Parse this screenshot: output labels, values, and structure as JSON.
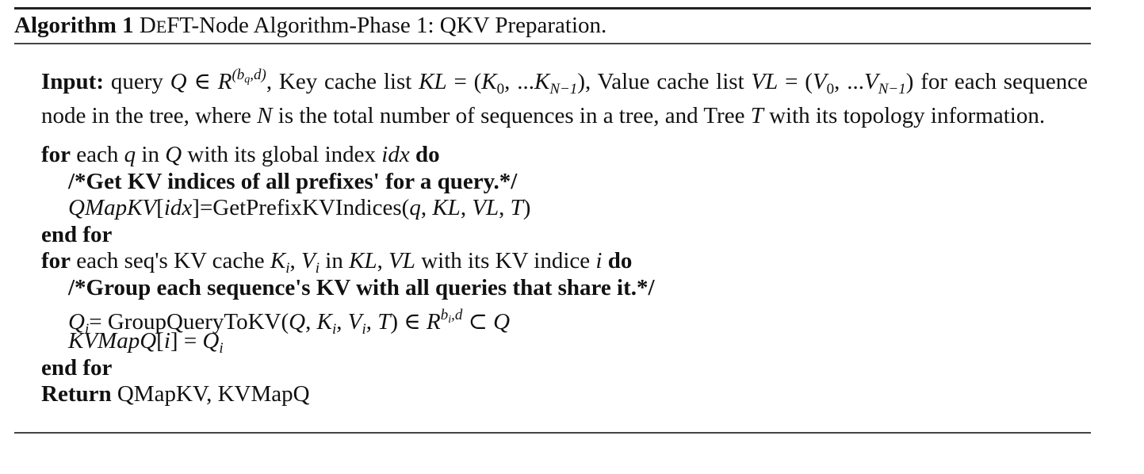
{
  "caption": [
    {
      "t": "Algorithm 1",
      "s": "b"
    },
    {
      "t": " D",
      "s": "n"
    },
    {
      "t": "E",
      "s": "sc"
    },
    {
      "t": "FT-Node Algorithm-Phase 1: QKV Preparation.",
      "s": "n"
    }
  ],
  "input": [
    {
      "t": "Input:",
      "s": "b"
    },
    {
      "t": "  query ",
      "s": "n"
    },
    {
      "t": "Q",
      "s": "i"
    },
    {
      "t": " ∈ ",
      "s": "n"
    },
    {
      "t": "R",
      "s": "i"
    },
    {
      "t": "(b",
      "s": "sup"
    },
    {
      "t": "q",
      "s": "supsub"
    },
    {
      "t": ",d)",
      "s": "sup"
    },
    {
      "t": ", Key cache list ",
      "s": "n"
    },
    {
      "t": "KL",
      "s": "i"
    },
    {
      "t": " = (",
      "s": "n"
    },
    {
      "t": "K",
      "s": "i"
    },
    {
      "t": "0",
      "s": "subn"
    },
    {
      "t": ", ...",
      "s": "n"
    },
    {
      "t": "K",
      "s": "i"
    },
    {
      "t": "N−1",
      "s": "sub"
    },
    {
      "t": "), Value cache list ",
      "s": "n"
    },
    {
      "t": "VL",
      "s": "i"
    },
    {
      "t": " = (",
      "s": "n"
    },
    {
      "t": "V",
      "s": "i"
    },
    {
      "t": "0",
      "s": "subn"
    },
    {
      "t": ", ...",
      "s": "n"
    },
    {
      "t": "V",
      "s": "i"
    },
    {
      "t": "N−1",
      "s": "sub"
    },
    {
      "t": ") for each sequence node in the tree, where ",
      "s": "n"
    },
    {
      "t": "N",
      "s": "i"
    },
    {
      "t": " is the total number of sequences in a tree, and Tree ",
      "s": "n"
    },
    {
      "t": "T",
      "s": "i"
    },
    {
      "t": " with its topology information.",
      "s": "n"
    }
  ],
  "lines": [
    {
      "indent": 0,
      "segs": [
        {
          "t": "for",
          "s": "b"
        },
        {
          "t": " each ",
          "s": "n"
        },
        {
          "t": "q",
          "s": "i"
        },
        {
          "t": " in ",
          "s": "n"
        },
        {
          "t": "Q",
          "s": "i"
        },
        {
          "t": " with its global index ",
          "s": "n"
        },
        {
          "t": "idx",
          "s": "i"
        },
        {
          "t": " do",
          "s": "b"
        }
      ]
    },
    {
      "indent": 1,
      "segs": [
        {
          "t": "/*Get KV indices of all prefixes' for a query.*/",
          "s": "b"
        }
      ]
    },
    {
      "indent": 1,
      "segs": [
        {
          "t": "QMapKV",
          "s": "i"
        },
        {
          "t": "[",
          "s": "n"
        },
        {
          "t": "idx",
          "s": "i"
        },
        {
          "t": "]=GetPrefixKVIndices(",
          "s": "n"
        },
        {
          "t": "q",
          "s": "i"
        },
        {
          "t": ", ",
          "s": "n"
        },
        {
          "t": "KL",
          "s": "i"
        },
        {
          "t": ", ",
          "s": "n"
        },
        {
          "t": "VL",
          "s": "i"
        },
        {
          "t": ", ",
          "s": "n"
        },
        {
          "t": "T",
          "s": "i"
        },
        {
          "t": ")",
          "s": "n"
        }
      ]
    },
    {
      "indent": 0,
      "segs": [
        {
          "t": "end for",
          "s": "b"
        }
      ]
    },
    {
      "indent": 0,
      "segs": [
        {
          "t": "for",
          "s": "b"
        },
        {
          "t": " each seq's KV cache ",
          "s": "n"
        },
        {
          "t": "K",
          "s": "i"
        },
        {
          "t": "i",
          "s": "sub"
        },
        {
          "t": ", ",
          "s": "n"
        },
        {
          "t": "V",
          "s": "i"
        },
        {
          "t": "i",
          "s": "sub"
        },
        {
          "t": " in ",
          "s": "n"
        },
        {
          "t": "KL",
          "s": "i"
        },
        {
          "t": ", ",
          "s": "n"
        },
        {
          "t": "VL",
          "s": "i"
        },
        {
          "t": " with its KV indice ",
          "s": "n"
        },
        {
          "t": "i",
          "s": "i"
        },
        {
          "t": " do",
          "s": "b"
        }
      ]
    },
    {
      "indent": 1,
      "segs": [
        {
          "t": "/*Group each sequence's KV with all queries that share it.*/",
          "s": "b"
        }
      ]
    },
    {
      "indent": 1,
      "segs": [
        {
          "t": "Q",
          "s": "i"
        },
        {
          "t": "i",
          "s": "sub"
        },
        {
          "t": "= GroupQueryToKV(",
          "s": "n"
        },
        {
          "t": "Q",
          "s": "i"
        },
        {
          "t": ", ",
          "s": "n"
        },
        {
          "t": "K",
          "s": "i"
        },
        {
          "t": "i",
          "s": "sub"
        },
        {
          "t": ", ",
          "s": "n"
        },
        {
          "t": "V",
          "s": "i"
        },
        {
          "t": "i",
          "s": "sub"
        },
        {
          "t": ", ",
          "s": "n"
        },
        {
          "t": "T",
          "s": "i"
        },
        {
          "t": ") ∈ ",
          "s": "n"
        },
        {
          "t": "R",
          "s": "i"
        },
        {
          "t": "b",
          "s": "sup"
        },
        {
          "t": "i",
          "s": "supsub"
        },
        {
          "t": ",d",
          "s": "sup"
        },
        {
          "t": " ⊂ ",
          "s": "n"
        },
        {
          "t": "Q",
          "s": "i"
        }
      ]
    },
    {
      "indent": 1,
      "segs": [
        {
          "t": "KVMapQ",
          "s": "i"
        },
        {
          "t": "[",
          "s": "n"
        },
        {
          "t": "i",
          "s": "i"
        },
        {
          "t": "] = ",
          "s": "n"
        },
        {
          "t": "Q",
          "s": "i"
        },
        {
          "t": "i",
          "s": "sub"
        }
      ]
    },
    {
      "indent": 0,
      "segs": [
        {
          "t": "end for",
          "s": "b"
        }
      ]
    },
    {
      "indent": 0,
      "segs": [
        {
          "t": "Return",
          "s": "b"
        },
        {
          "t": " QMapKV, KVMapQ",
          "s": "n"
        }
      ]
    }
  ]
}
